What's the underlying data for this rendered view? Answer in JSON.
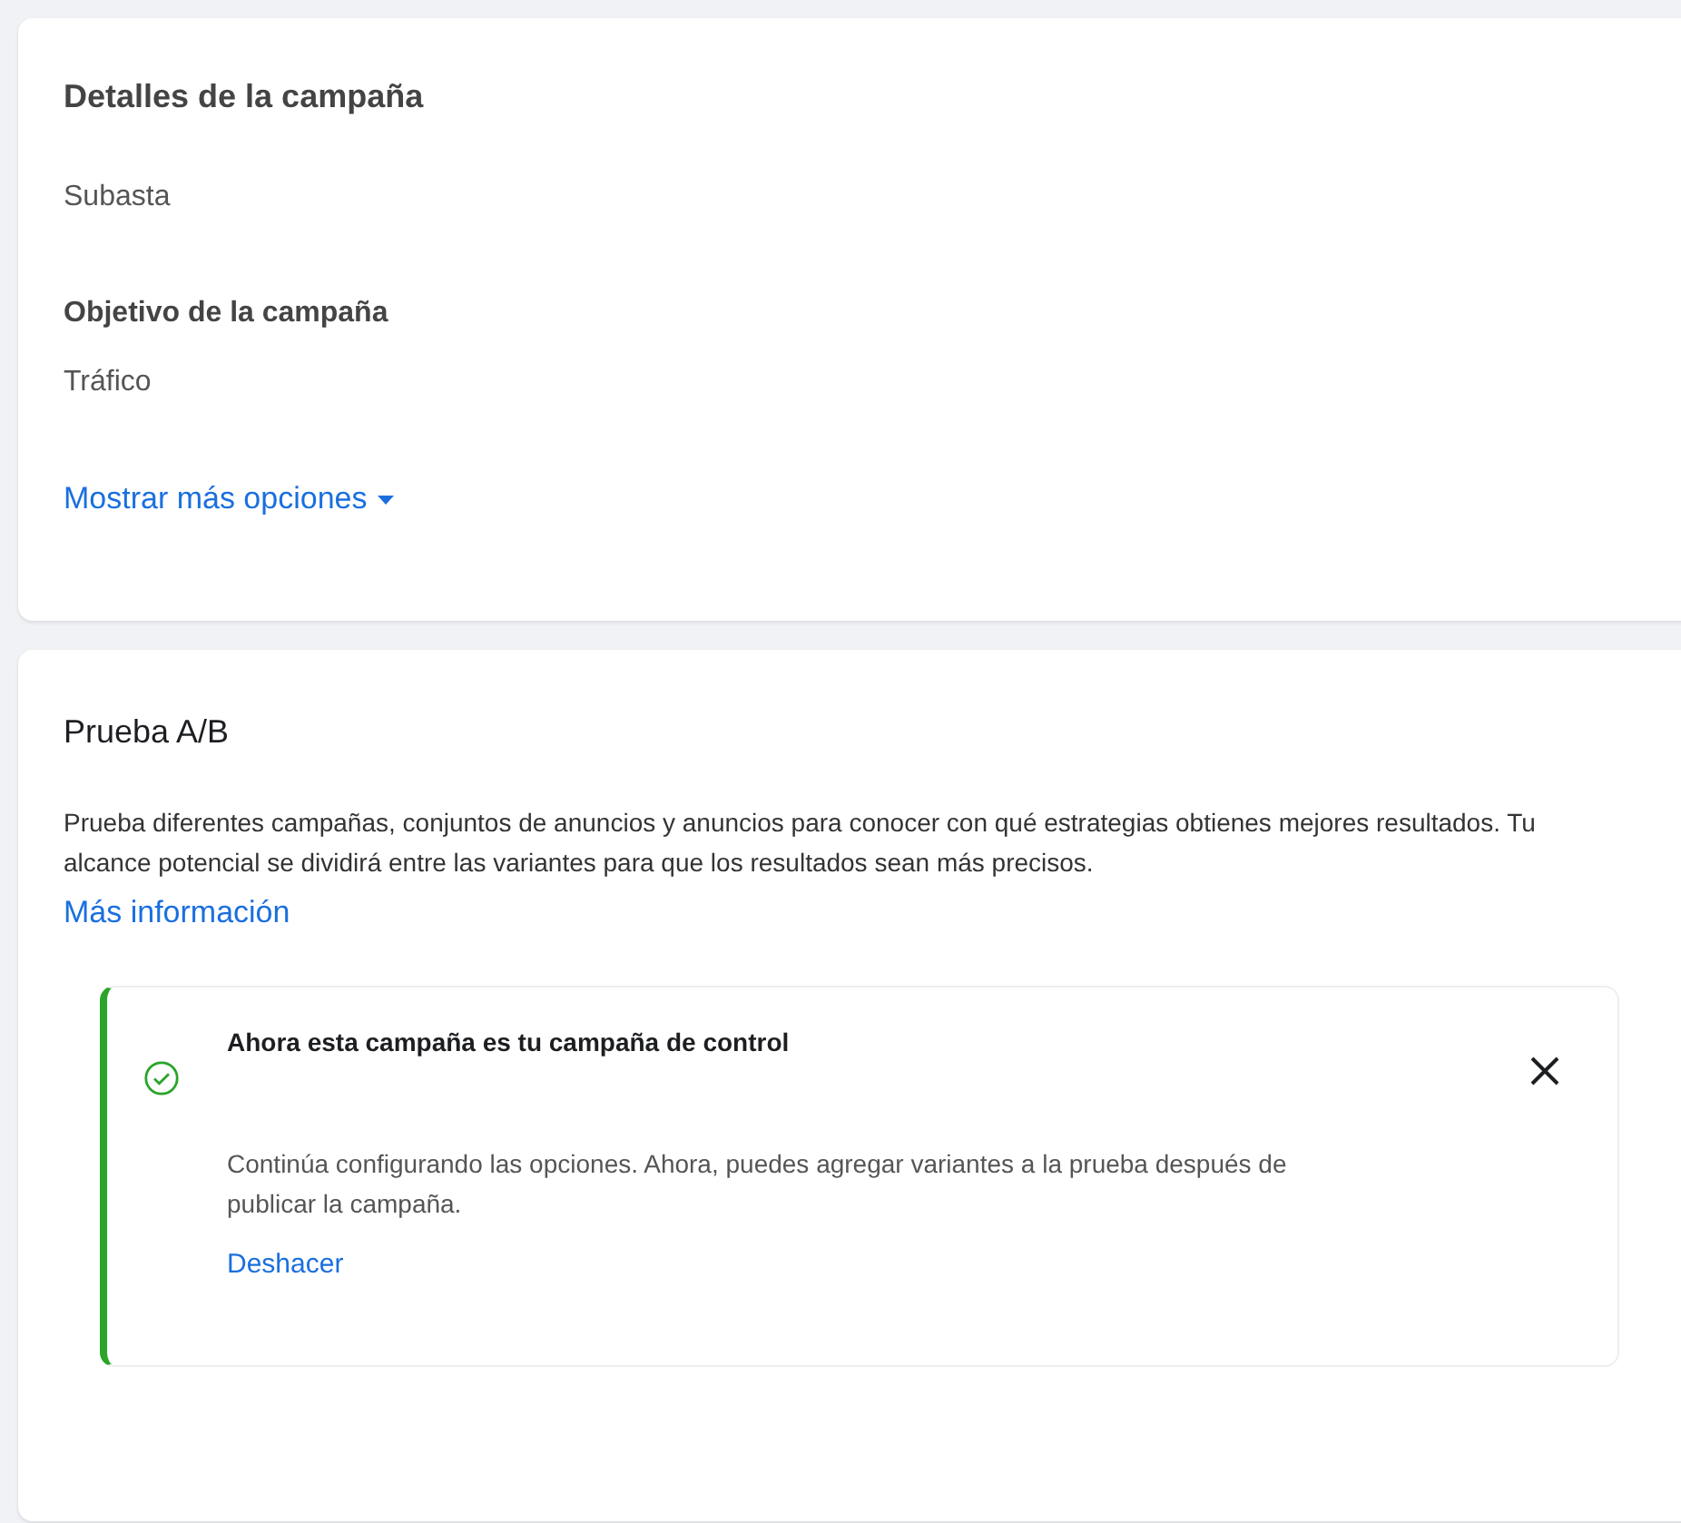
{
  "campaign_details": {
    "title": "Detalles de la campaña",
    "buying_type": "Subasta",
    "objective_label": "Objetivo de la campaña",
    "objective_value": "Tráfico",
    "show_more": "Mostrar más opciones"
  },
  "ab_test": {
    "title": "Prueba A/B",
    "description": "Prueba diferentes campañas, conjuntos de anuncios y anuncios para conocer con qué estrategias obtienes mejores resultados. Tu alcance potencial se dividirá entre las variantes para que los resultados sean más precisos.",
    "learn_more": "Más información",
    "notice": {
      "kind": "success",
      "title": "Ahora esta campaña es tu campaña de control",
      "body": "Continúa configurando las opciones. Ahora, puedes agregar variantes a la prueba después de publicar la campaña.",
      "undo": "Deshacer"
    }
  }
}
